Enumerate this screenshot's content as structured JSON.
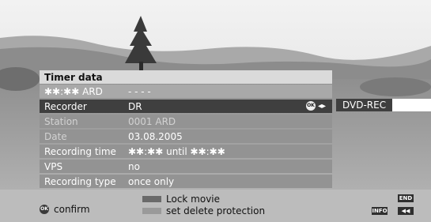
{
  "panel": {
    "title": "Timer data",
    "channel_time": "✱✱:✱✱",
    "channel_name": "ARD",
    "channel_value": "- - - -",
    "rows": [
      {
        "label": "Recorder",
        "value": "DR"
      },
      {
        "label": "Station",
        "value": "0001 ARD"
      },
      {
        "label": "Date",
        "value": "03.08.2005"
      },
      {
        "label": "Recording time",
        "value_start": "✱✱:✱✱",
        "value_mid": "until",
        "value_end": "✱✱:✱✱"
      },
      {
        "label": "VPS",
        "value": "no"
      },
      {
        "label": "Recording type",
        "value": "once only"
      }
    ],
    "selected_option": "DVD-REC"
  },
  "footer": {
    "ok_badge": "OK",
    "confirm_label": "confirm",
    "legend": [
      {
        "label": "Lock movie",
        "color": "#6a6a6a"
      },
      {
        "label": "set delete protection",
        "color": "#9a9a9a"
      }
    ],
    "end_button": "END",
    "info_button": "INFO",
    "rewind_button": "◀◀"
  }
}
